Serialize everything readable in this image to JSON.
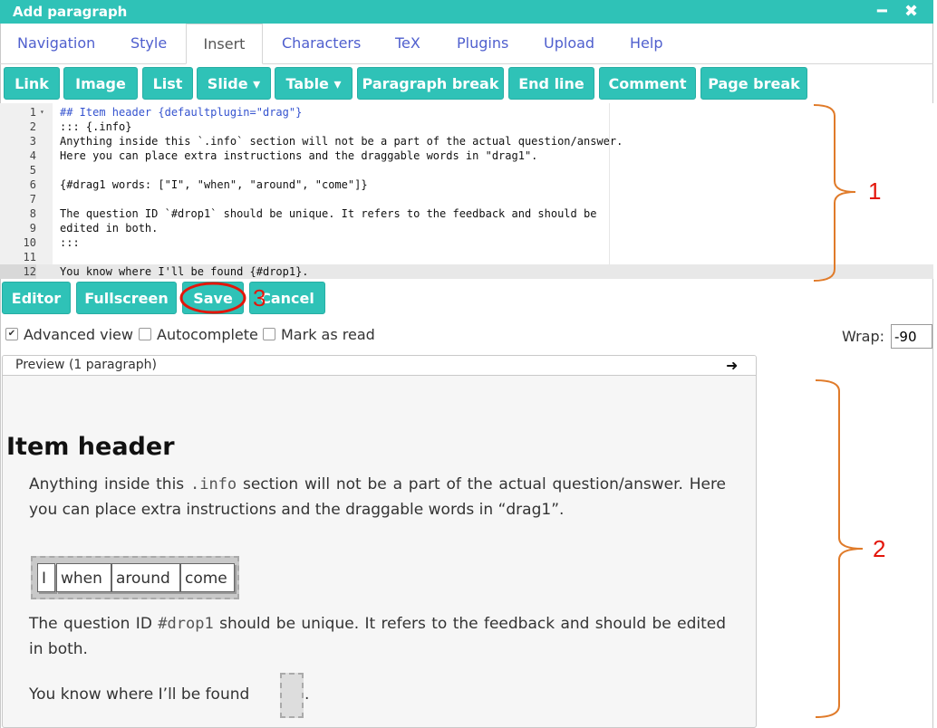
{
  "window": {
    "title": "Add paragraph",
    "minimize_glyph": "━",
    "close_glyph": "✖"
  },
  "tabs": [
    {
      "label": "Navigation",
      "active": false
    },
    {
      "label": "Style",
      "active": false
    },
    {
      "label": "Insert",
      "active": true
    },
    {
      "label": "Characters",
      "active": false
    },
    {
      "label": "TeX",
      "active": false
    },
    {
      "label": "Plugins",
      "active": false
    },
    {
      "label": "Upload",
      "active": false
    },
    {
      "label": "Help",
      "active": false
    }
  ],
  "toolbar": {
    "buttons": [
      {
        "label": "Link"
      },
      {
        "label": "Image"
      },
      {
        "label": "List"
      },
      {
        "label": "Slide ▾"
      },
      {
        "label": "Table ▾"
      },
      {
        "label": "Paragraph break"
      },
      {
        "label": "End line"
      },
      {
        "label": "Comment"
      },
      {
        "label": "Page break"
      }
    ]
  },
  "editor": {
    "lines": [
      {
        "num": "1",
        "fold": "▾",
        "text": "## Item header {defaultplugin=\"drag\"}",
        "blue": true
      },
      {
        "num": "2",
        "fold": "",
        "text": "::: {.info}",
        "blue": false
      },
      {
        "num": "3",
        "fold": "",
        "text": "Anything inside this `.info` section will not be a part of the actual question/answer.",
        "blue": false
      },
      {
        "num": "4",
        "fold": "",
        "text": "Here you can place extra instructions and the draggable words in \"drag1\".",
        "blue": false
      },
      {
        "num": "5",
        "fold": "",
        "text": "",
        "blue": false
      },
      {
        "num": "6",
        "fold": "",
        "text": "{#drag1 words: [\"I\", \"when\", \"around\", \"come\"]}",
        "blue": false
      },
      {
        "num": "7",
        "fold": "",
        "text": "",
        "blue": false
      },
      {
        "num": "8",
        "fold": "",
        "text": "The question ID `#drop1` should be unique. It refers to the feedback and should be",
        "blue": false
      },
      {
        "num": "9",
        "fold": "",
        "text": "edited in both.",
        "blue": false
      },
      {
        "num": "10",
        "fold": "",
        "text": ":::",
        "blue": false
      },
      {
        "num": "11",
        "fold": "",
        "text": "",
        "blue": false
      },
      {
        "num": "12",
        "fold": "",
        "text": "You know where I'll be found {#drop1}.",
        "blue": false
      }
    ]
  },
  "action_buttons": {
    "editor": "Editor",
    "fullscreen": "Fullscreen",
    "save": "Save",
    "cancel": "Cancel"
  },
  "options": {
    "advanced_view": {
      "label": "Advanced view",
      "checked": true
    },
    "autocomplete": {
      "label": "Autocomplete",
      "checked": false
    },
    "mark_as_read": {
      "label": "Mark as read",
      "checked": false
    },
    "wrap_label": "Wrap:",
    "wrap_value": "-90"
  },
  "preview": {
    "header": "Preview (1 paragraph)",
    "arrow": "➜",
    "heading": "Item header",
    "info_1": "Anything inside this",
    "info_code": ".info",
    "info_2": "section will not be a part of the actual question/answer. Here you can place extra instructions and the draggable words in “drag1”.",
    "words": [
      "I",
      "when",
      "around",
      "come"
    ],
    "q_1": "The question ID",
    "q_code": "#drop1",
    "q_2": "should be unique. It refers to the feedback and should be edited in both.",
    "found": "You know where I’ll be found",
    "found_end": "."
  },
  "annotations": {
    "one": "1",
    "two": "2",
    "three": "3"
  },
  "colors": {
    "accent": "#2fc2b7",
    "tab_link": "#4f5fce",
    "annotation_bracket": "#e07b2a",
    "annotation_circle": "#e3160b"
  }
}
